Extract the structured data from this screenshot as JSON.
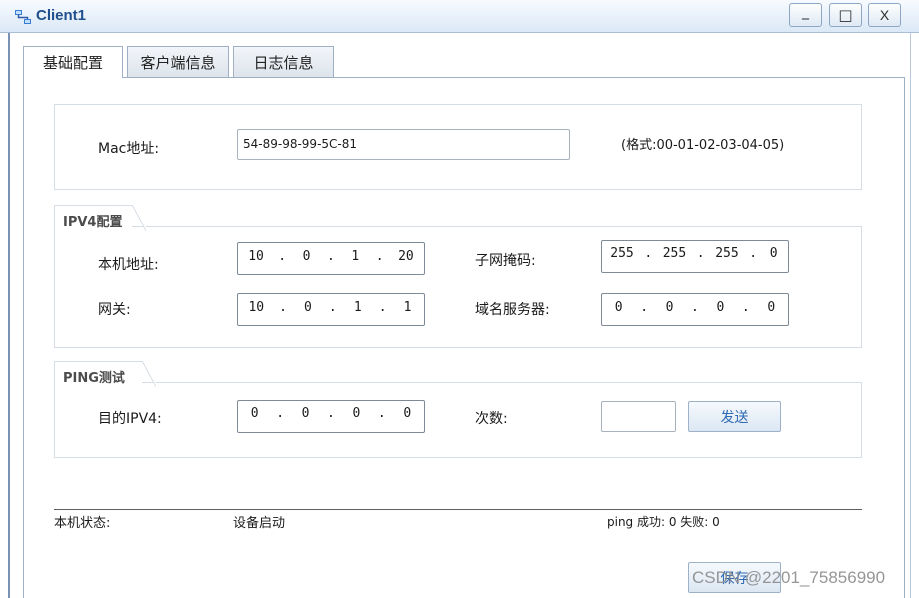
{
  "window": {
    "title": "Client1",
    "controls": {
      "minimize": "_",
      "maximize": "□",
      "close": "X"
    }
  },
  "tabs": [
    {
      "label": "基础配置",
      "active": true
    },
    {
      "label": "客户端信息",
      "active": false
    },
    {
      "label": "日志信息",
      "active": false
    }
  ],
  "mac": {
    "label": "Mac地址:",
    "value": "54-89-98-99-5C-81",
    "format_hint": "(格式:00-01-02-03-04-05)"
  },
  "ipv4": {
    "group_title": "IPV4配置",
    "local_label": "本机地址:",
    "local_ip": [
      "10",
      "0",
      "1",
      "20"
    ],
    "mask_label": "子网掩码:",
    "mask": [
      "255",
      "255",
      "255",
      "0"
    ],
    "gateway_label": "网关:",
    "gateway": [
      "10",
      "0",
      "1",
      "1"
    ],
    "dns_label": "域名服务器:",
    "dns": [
      "0",
      "0",
      "0",
      "0"
    ]
  },
  "ping": {
    "group_title": "PING测试",
    "target_label": "目的IPV4:",
    "target": [
      "0",
      "0",
      "0",
      "0"
    ],
    "count_label": "次数:",
    "count_value": "",
    "send_label": "发送"
  },
  "status": {
    "label": "本机状态:",
    "value": "设备启动",
    "ping_result": "ping 成功: 0 失败: 0"
  },
  "save_label": "保存",
  "watermark": "CSDN @2201_75856990",
  "colors": {
    "title": "#1f4f8c",
    "button_text": "#2e69b3"
  }
}
